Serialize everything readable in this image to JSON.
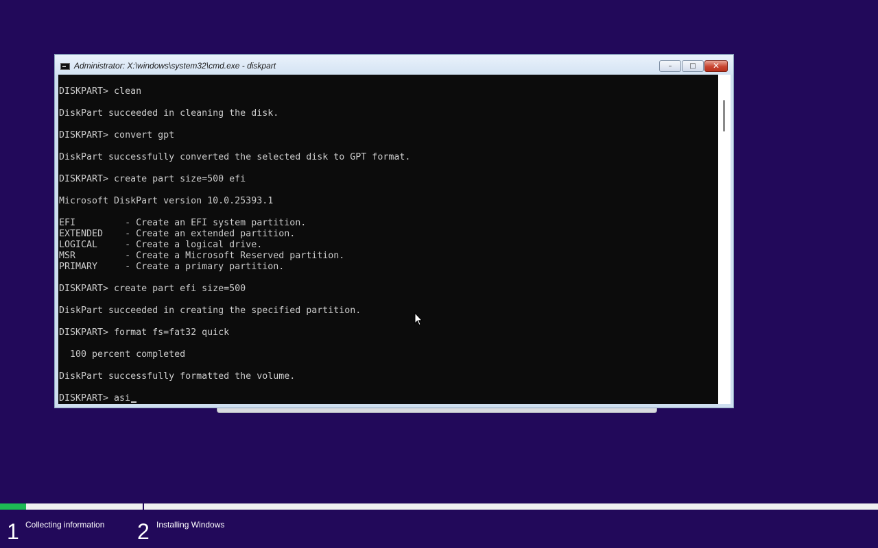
{
  "window": {
    "title": "Administrator: X:\\windows\\system32\\cmd.exe - diskpart",
    "minimize_glyph": "–",
    "maximize_glyph": "□",
    "close_glyph": "✕"
  },
  "console": {
    "lines": [
      "DISKPART> clean",
      "",
      "DiskPart succeeded in cleaning the disk.",
      "",
      "DISKPART> convert gpt",
      "",
      "DiskPart successfully converted the selected disk to GPT format.",
      "",
      "DISKPART> create part size=500 efi",
      "",
      "Microsoft DiskPart version 10.0.25393.1",
      "",
      "EFI         - Create an EFI system partition.",
      "EXTENDED    - Create an extended partition.",
      "LOGICAL     - Create a logical drive.",
      "MSR         - Create a Microsoft Reserved partition.",
      "PRIMARY     - Create a primary partition.",
      "",
      "DISKPART> create part efi size=500",
      "",
      "DiskPart succeeded in creating the specified partition.",
      "",
      "DISKPART> format fs=fat32 quick",
      "",
      "  100 percent completed",
      "",
      "DiskPart successfully formatted the volume.",
      ""
    ],
    "prompt_line": "DISKPART> asi"
  },
  "setup_progress": {
    "overall_fraction": 0.03,
    "steps": [
      {
        "number": "1",
        "label": "Collecting information"
      },
      {
        "number": "2",
        "label": "Installing Windows"
      }
    ]
  },
  "colors": {
    "desktop_bg": "#22095a",
    "console_bg": "#0c0c0c",
    "console_fg": "#cccccc",
    "progress_fill": "#1db954"
  },
  "icons": {
    "app": "cmd-icon",
    "cursor": "mouse-pointer-icon"
  }
}
